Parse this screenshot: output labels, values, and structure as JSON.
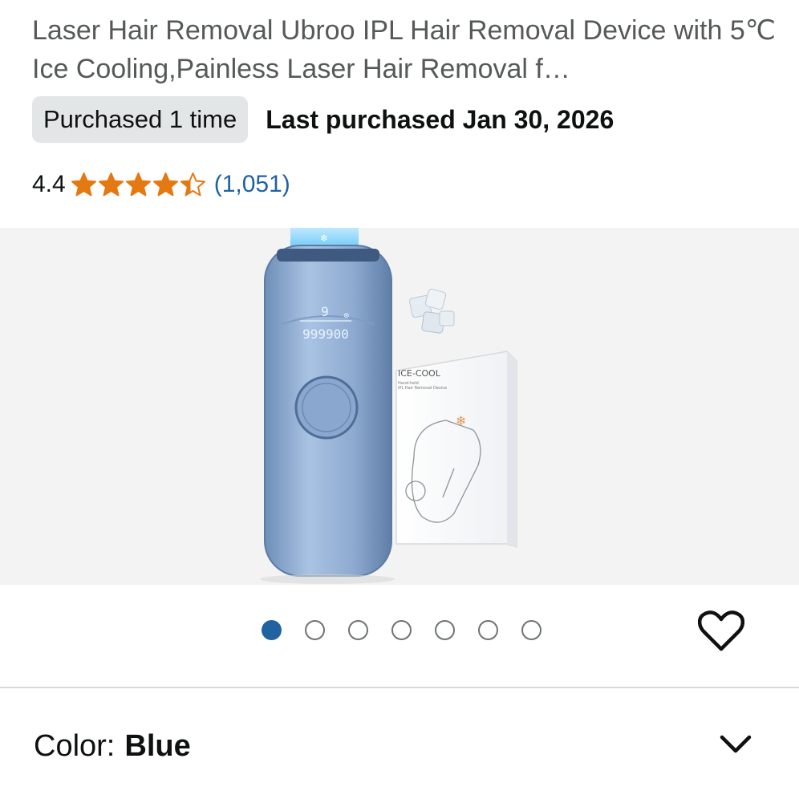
{
  "product": {
    "title": "Laser Hair Removal Ubroo IPL Hair Removal Device with 5℃ Ice Cooling,Painless Laser Hair Removal f…"
  },
  "purchase": {
    "badge": "Purchased 1 time",
    "last_purchased": "Last purchased Jan 30, 2026"
  },
  "rating": {
    "value": "4.4",
    "stars": 4.4,
    "count": "(1,051)",
    "star_color": "#e47911"
  },
  "gallery": {
    "image_count": 7,
    "active_index": 0,
    "device_display": {
      "level": "9",
      "flash_count": "999900"
    },
    "box": {
      "brand": "ICE-COOL",
      "subtitle1": "Hand-held",
      "subtitle2": "IPL Hair Removal Device"
    }
  },
  "icons": {
    "wishlist": "heart-icon",
    "expand": "chevron-down-icon"
  },
  "variation": {
    "label": "Color:",
    "value": "Blue"
  },
  "colors": {
    "link": "#2162a1",
    "active_dot": "#2162a1",
    "badge_bg": "#e3e6e6"
  }
}
